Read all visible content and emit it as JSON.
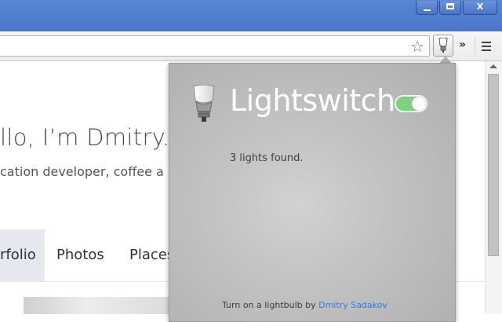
{
  "page": {
    "greeting": "llo, I’m Dmitry.",
    "tagline": "cation developer, coffee a",
    "nav": [
      "rfolio",
      "Photos",
      "Places"
    ]
  },
  "window_controls": {
    "close_label": "X"
  },
  "toolbar": {
    "star_icon": "star-icon",
    "overflow_label": "»"
  },
  "popup": {
    "title": "Lightswitch",
    "toggle_on": true,
    "status": "3 lights found.",
    "footer_text": "Turn on a lightbulb by",
    "footer_link": "Dmitry Sadakov",
    "accent_color": "#7bd37d",
    "link_color": "#2f7fd8"
  }
}
